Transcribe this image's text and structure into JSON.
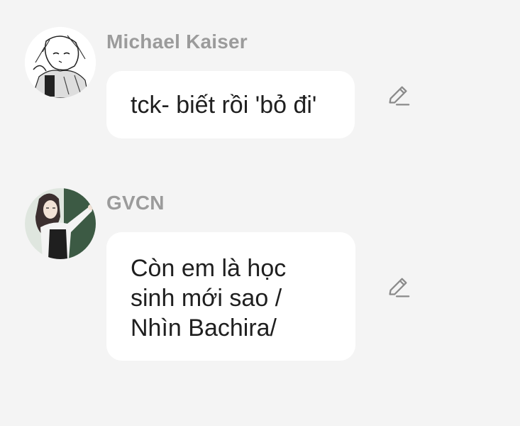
{
  "messages": [
    {
      "sender": "Michael Kaiser",
      "lines": [
        "tck- biết rồi 'bỏ đi'"
      ],
      "avatar_icon": "manga-character-avatar",
      "edit_icon": "pencil-edit-icon"
    },
    {
      "sender": "GVCN",
      "lines": [
        "Còn em là học",
        "sinh mới sao /",
        "Nhìn Bachira/"
      ],
      "avatar_icon": "teacher-character-avatar",
      "edit_icon": "pencil-edit-icon"
    }
  ],
  "colors": {
    "background": "#f4f4f4",
    "bubble": "#ffffff",
    "sender_text": "#9b9b9b",
    "message_text": "#1f1f1f",
    "icon": "#8a8a8a"
  }
}
